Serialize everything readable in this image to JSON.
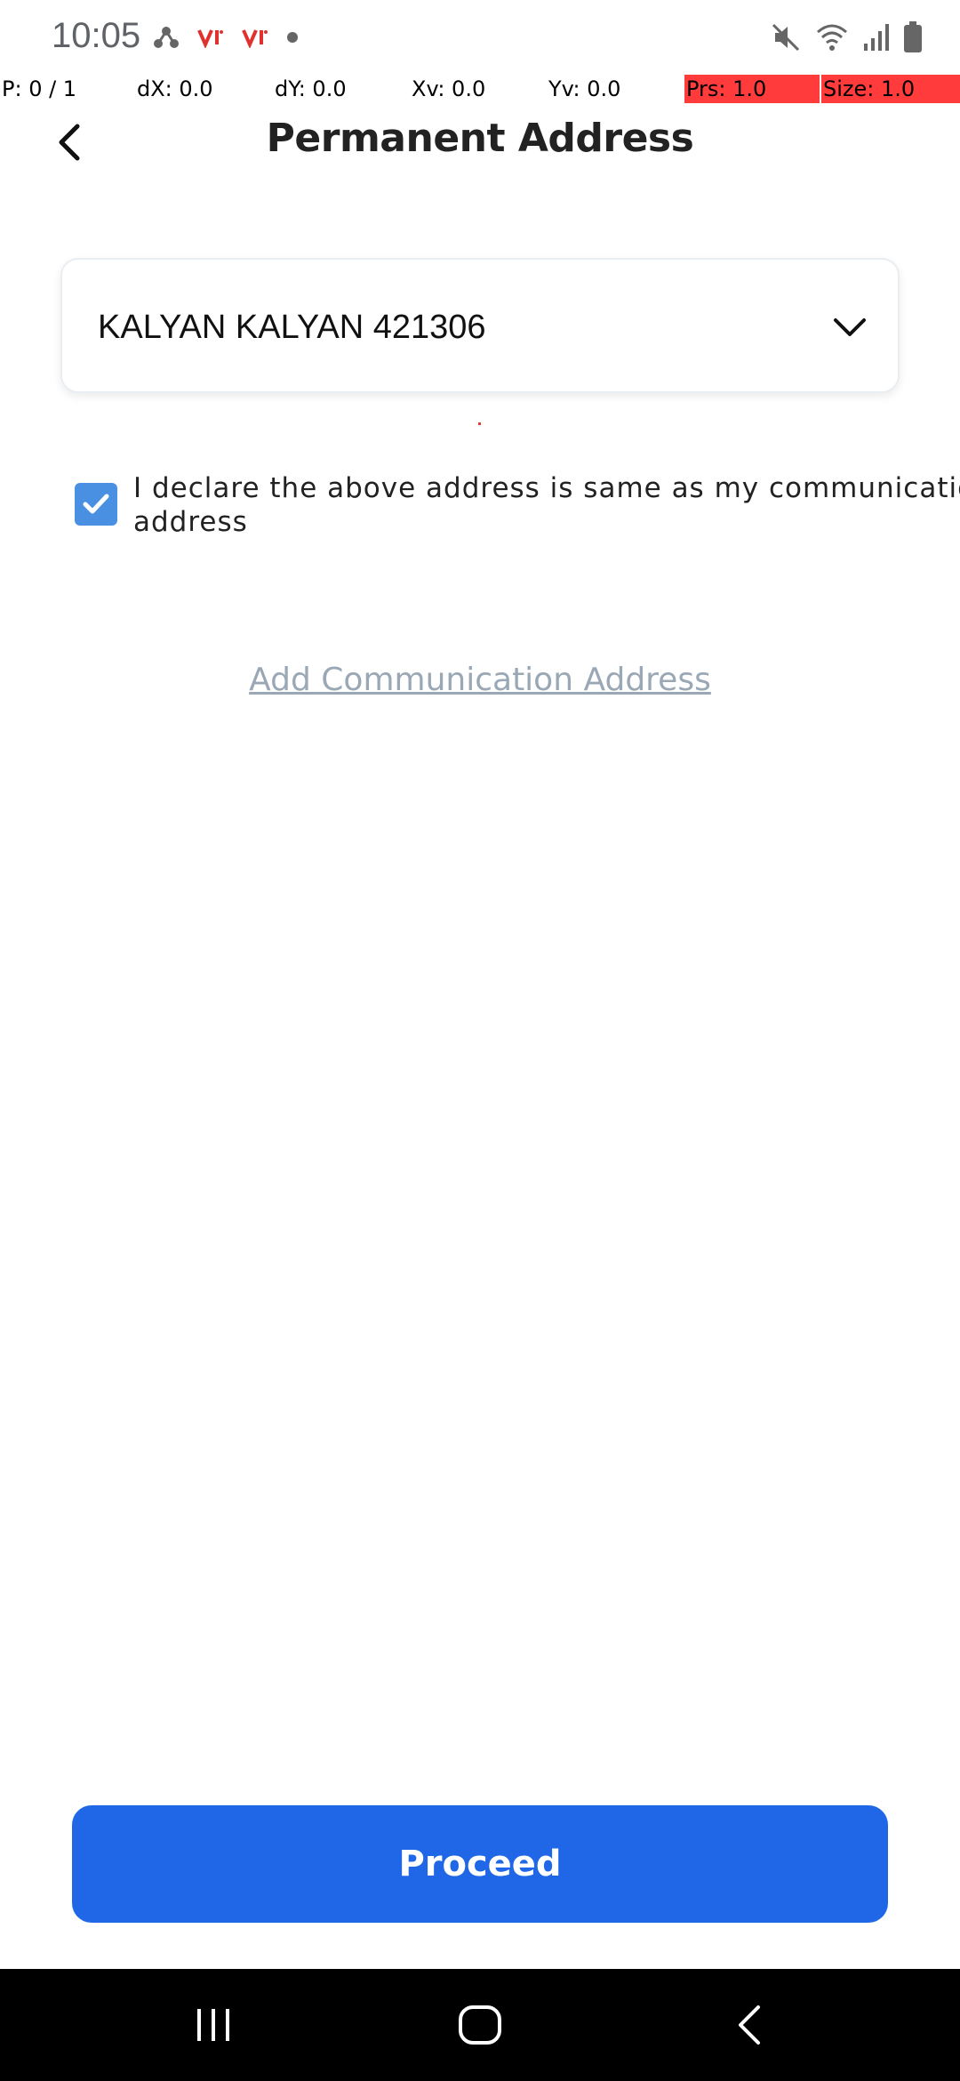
{
  "status_bar": {
    "time": "10:05",
    "left_icons": [
      "network-share-icon",
      "vi-carrier-icon",
      "vi-carrier-icon",
      "notification-dot-icon"
    ],
    "right_icons": [
      "mute-icon",
      "wifi-icon",
      "signal-icon",
      "battery-icon"
    ]
  },
  "pointer_overlay": {
    "p": "P: 0 / 1",
    "dx": "dX: 0.0",
    "dy": "dY: 0.0",
    "xv": "Xv: 0.0",
    "yv": "Yv: 0.0",
    "prs": "Prs: 1.0",
    "size": "Size: 1.0"
  },
  "header": {
    "title": "Permanent Address",
    "back_icon": "chevron-left-icon"
  },
  "address": {
    "selected_value": "KALYAN KALYAN 421306",
    "dropdown_icon": "chevron-down-icon"
  },
  "declaration": {
    "checked": true,
    "line1": "I declare the above address is same as my communication",
    "line2": "address"
  },
  "link": {
    "label": "Add Communication Address"
  },
  "actions": {
    "proceed_label": "Proceed"
  },
  "nav_bar": {
    "buttons": [
      "recent-apps-icon",
      "home-icon",
      "back-icon"
    ]
  },
  "colors": {
    "primary": "#1f67e6",
    "checkbox": "#4a90e2",
    "link": "#9aa8b6",
    "overlay_highlight": "#ff3b3b"
  }
}
